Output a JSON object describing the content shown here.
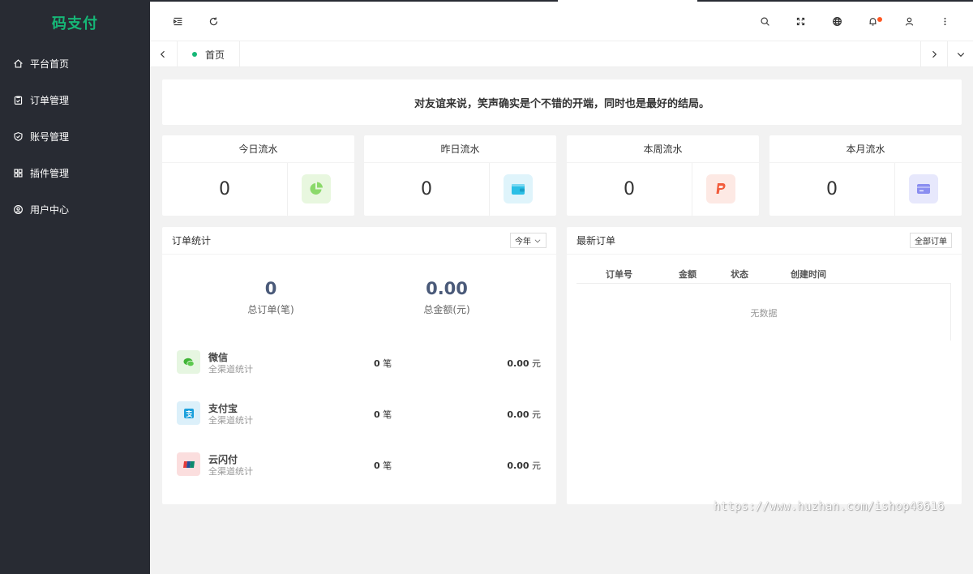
{
  "brand": "码支付",
  "sidebar": {
    "items": [
      {
        "label": "平台首页",
        "icon": "home-icon"
      },
      {
        "label": "订单管理",
        "icon": "clipboard-check-icon"
      },
      {
        "label": "账号管理",
        "icon": "shield-check-icon"
      },
      {
        "label": "插件管理",
        "icon": "grid-icon"
      },
      {
        "label": "用户中心",
        "icon": "user-circle-icon"
      }
    ]
  },
  "header": {
    "icons": [
      "indent-icon",
      "refresh-icon",
      "search-icon",
      "fullscreen-icon",
      "globe-icon",
      "bell-icon",
      "user-icon",
      "more-vertical-icon"
    ]
  },
  "tabs": {
    "home_label": "首页"
  },
  "quote": "对友谊来说，笑声确实是个不错的开端，同时也是最好的结局。",
  "stats": [
    {
      "title": "今日流水",
      "value": "0",
      "icon": "pie-chart-icon",
      "color": "#8bd96a",
      "bg": "#e8f7df"
    },
    {
      "title": "昨日流水",
      "value": "0",
      "icon": "wallet-icon",
      "color": "#2bbfe6",
      "bg": "#dff4fb"
    },
    {
      "title": "本周流水",
      "value": "0",
      "icon": "paypal-icon",
      "color": "#f25c3c",
      "bg": "#fde9e4"
    },
    {
      "title": "本月流水",
      "value": "0",
      "icon": "card-icon",
      "color": "#8a8ef0",
      "bg": "#e7e8fc"
    }
  ],
  "orders": {
    "title": "订单统计",
    "period": "今年",
    "total_orders": "0",
    "total_orders_label": "总订单(笔)",
    "total_amount": "0.00",
    "total_amount_label": "总金额(元)",
    "channels": [
      {
        "name": "微信",
        "sub": "全渠道统计",
        "count": "0",
        "count_unit": "笔",
        "amount": "0.00",
        "amount_unit": "元",
        "icon": "wechat-icon",
        "color": "#3fb435",
        "bg": "#e6f6e1"
      },
      {
        "name": "支付宝",
        "sub": "全渠道统计",
        "count": "0",
        "count_unit": "笔",
        "amount": "0.00",
        "amount_unit": "元",
        "icon": "alipay-icon",
        "color": "#1ba0dc",
        "bg": "#dcf0fa"
      },
      {
        "name": "云闪付",
        "sub": "全渠道统计",
        "count": "0",
        "count_unit": "笔",
        "amount": "0.00",
        "amount_unit": "元",
        "icon": "unionpay-icon",
        "color": "#e23a3a",
        "bg": "#fbdede"
      }
    ]
  },
  "latest": {
    "title": "最新订单",
    "all_button": "全部订单",
    "columns": [
      "订单号",
      "金额",
      "状态",
      "创建时间"
    ],
    "empty": "无数据"
  },
  "watermark": "https://www.huzhan.com/ishop46616"
}
